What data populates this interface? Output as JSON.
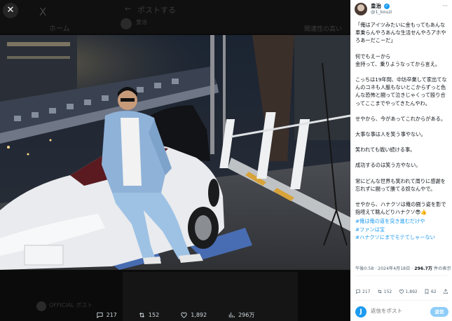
{
  "background": {
    "x_logo": "X",
    "home_label": "ホーム",
    "back_arrow": "←",
    "post_title": "ポストする",
    "post_author": "皇治",
    "context_label": "関連性の高い",
    "footer_text": "OFFICIAL ポスト"
  },
  "viewer": {
    "close_label": "✕",
    "actions": [
      {
        "icon": "reply-icon",
        "count": "217"
      },
      {
        "icon": "repost-icon",
        "count": "152"
      },
      {
        "icon": "like-icon",
        "count": "1,892"
      },
      {
        "icon": "views-icon",
        "count": "296万"
      }
    ]
  },
  "post": {
    "author_name": "皇治",
    "handle": "@1_kouzi",
    "more": "···",
    "paragraphs": [
      "「俺はアイツみたいに金もってもあんな車乗らんやろあんな生活せんやろアホやろあーだこーだ」",
      "何でもえーから\n金持って、乗りようなってから言え。",
      "こっちは19年間、中坊卒業して家出てなんのコネも人脈もないとこからずっと色んな恐怖と闘って泣きじゃくって殴り合ってここまでやってきたんやわ。",
      "せやから、今があってこれからがある。",
      "大事な事は人を笑う事やない。",
      "笑われても戦い続ける事。",
      "成功するのは笑う方やない。",
      "常にどんな世界も笑われて周りに感謝を忘れずに闘って勝てる奴なんやで。",
      "せやから、ハナクソは俺の闘う姿を影で指咥えて眺んどりハナクソ😎👍"
    ],
    "hashtags": [
      "#俺は俺の道を突き進むだけや",
      "#ファンは宝",
      "#ハナクソにまでモテてしゃーない"
    ],
    "time": "午後0:58 · 2024年4月18日 · ",
    "views": "296.7万",
    "views_label": " 件の表示",
    "stats": [
      {
        "icon": "reply-icon",
        "count": "217"
      },
      {
        "icon": "repost-icon",
        "count": "152"
      },
      {
        "icon": "like-icon",
        "count": "1,892"
      },
      {
        "icon": "bookmark-icon",
        "count": "62"
      }
    ]
  },
  "reply": {
    "avatar_letter": "J",
    "placeholder": "返信をポスト",
    "button_label": "返信"
  }
}
